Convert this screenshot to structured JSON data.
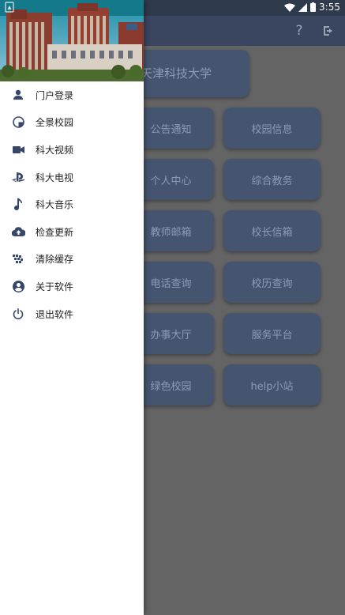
{
  "status_bar": {
    "time": "3:55"
  },
  "app": {
    "title": "天津科技大学",
    "tiles_left": [
      "公告通知",
      "个人中心",
      "教师邮箱",
      "电话查询",
      "办事大厅",
      "绿色校园"
    ],
    "tiles_right": [
      "校园信息",
      "综合教务",
      "校长信箱",
      "校历查询",
      "服务平台",
      "help小站"
    ],
    "actions": {
      "help_icon": "question-mark-icon",
      "exit_icon": "logout-icon"
    }
  },
  "drawer": {
    "items": [
      {
        "label": "门户登录",
        "icon": "person-icon"
      },
      {
        "label": "全景校园",
        "icon": "panorama-icon"
      },
      {
        "label": "科大视频",
        "icon": "video-camera-icon"
      },
      {
        "label": "科大电视",
        "icon": "tv-logo-icon"
      },
      {
        "label": "科大音乐",
        "icon": "music-note-icon"
      },
      {
        "label": "检查更新",
        "icon": "cloud-upload-icon"
      },
      {
        "label": "清除缓存",
        "icon": "broom-dots-icon"
      },
      {
        "label": "关于软件",
        "icon": "account-circle-icon"
      },
      {
        "label": "退出软件",
        "icon": "power-icon"
      }
    ]
  },
  "colors": {
    "accent": "#37476a",
    "drawer_bg": "#ffffff",
    "tile_bg": "#45546f"
  }
}
